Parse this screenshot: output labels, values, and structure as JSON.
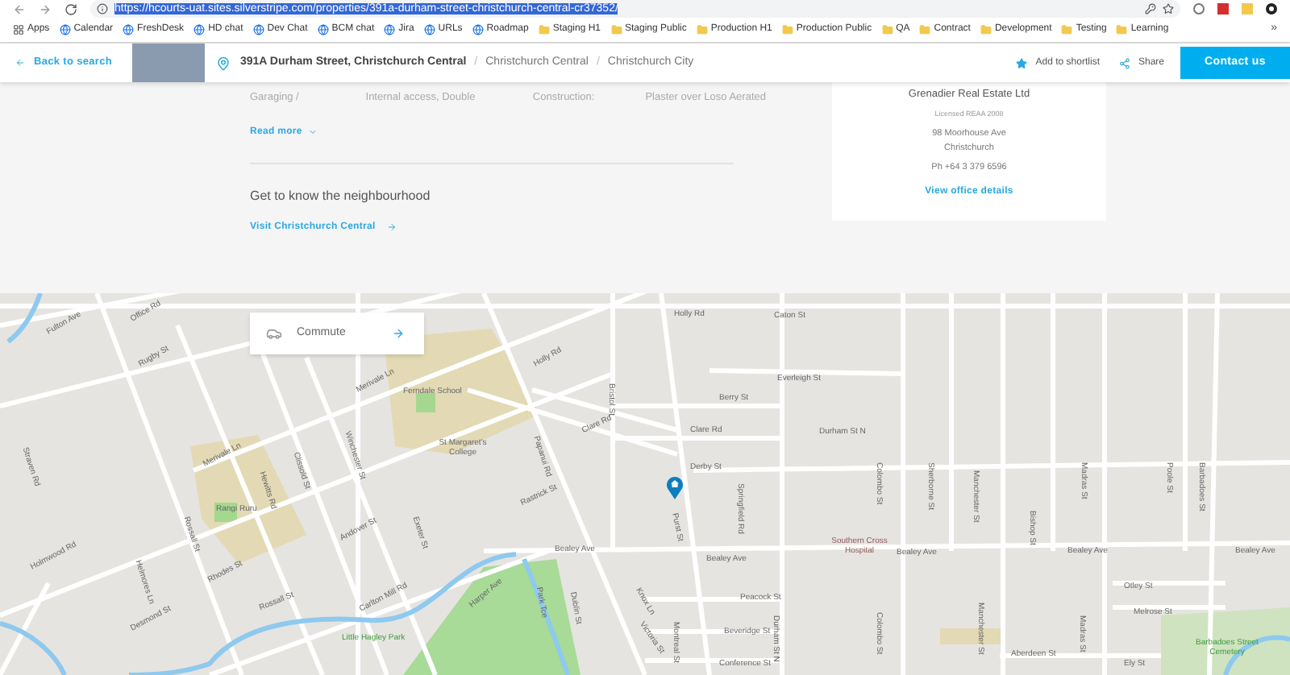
{
  "browser": {
    "url": "https://hcourts-uat.sites.silverstripe.com/properties/391a-durham-street-christchurch-central-cr37352/",
    "bookmarks": [
      {
        "label": "Apps",
        "kind": "apps"
      },
      {
        "label": "Calendar",
        "kind": "site"
      },
      {
        "label": "FreshDesk",
        "kind": "site"
      },
      {
        "label": "HD chat",
        "kind": "site"
      },
      {
        "label": "Dev Chat",
        "kind": "site"
      },
      {
        "label": "BCM chat",
        "kind": "site"
      },
      {
        "label": "Jira",
        "kind": "site"
      },
      {
        "label": "URLs",
        "kind": "site"
      },
      {
        "label": "Roadmap",
        "kind": "site"
      },
      {
        "label": "Staging H1",
        "kind": "folder"
      },
      {
        "label": "Staging Public",
        "kind": "folder"
      },
      {
        "label": "Production H1",
        "kind": "folder"
      },
      {
        "label": "Production Public",
        "kind": "folder"
      },
      {
        "label": "QA",
        "kind": "folder"
      },
      {
        "label": "Contract",
        "kind": "folder"
      },
      {
        "label": "Development",
        "kind": "folder"
      },
      {
        "label": "Testing",
        "kind": "folder"
      },
      {
        "label": "Learning",
        "kind": "folder"
      }
    ],
    "more": "»"
  },
  "header": {
    "back": "Back to search",
    "address": "391A Durham Street, Christchurch Central",
    "breadcrumbs": [
      "Christchurch Central",
      "Christchurch City"
    ],
    "separator": "/",
    "shortlist": "Add to shortlist",
    "share": "Share",
    "contact": "Contact us"
  },
  "details": {
    "row": [
      "Garaging /",
      "Internal access, Double",
      "Construction:",
      "Plaster over Loso Aerated"
    ],
    "read_more": "Read more",
    "neighbourhood_heading": "Get to know the neighbourhood",
    "visit_link": "Visit Christchurch Central"
  },
  "agency": {
    "name": "Grenadier Real Estate Ltd",
    "licence": "Licensed REAA 2008",
    "address_lines": [
      "98 Moorhouse Ave",
      "Christchurch"
    ],
    "phone": "Ph +64 3 379 6596",
    "link": "View office details"
  },
  "map": {
    "commute": "Commute",
    "labels": [
      {
        "text": "Fulton Ave"
      },
      {
        "text": "Office Rd"
      },
      {
        "text": "Rugby St"
      },
      {
        "text": "Merivale Ln"
      },
      {
        "text": "Ferndale School",
        "kind": "school"
      },
      {
        "text": "St Margaret's College",
        "kind": "school"
      },
      {
        "text": "Merivale Ln"
      },
      {
        "text": "Rangi Ruru",
        "kind": "school"
      },
      {
        "text": "Holly Rd"
      },
      {
        "text": "Holly Rd"
      },
      {
        "text": "Caton St"
      },
      {
        "text": "Papanui Rd"
      },
      {
        "text": "Clare Rd"
      },
      {
        "text": "Clare Rd"
      },
      {
        "text": "Berry St"
      },
      {
        "text": "Everleigh St"
      },
      {
        "text": "Durham St N"
      },
      {
        "text": "Derby St"
      },
      {
        "text": "Bristol St"
      },
      {
        "text": "Springfield Rd"
      },
      {
        "text": "Purst St"
      },
      {
        "text": "Bealey Ave"
      },
      {
        "text": "Bealey Ave"
      },
      {
        "text": "Southern Cross Hospital",
        "kind": "hospital"
      },
      {
        "text": "Bealey Ave"
      },
      {
        "text": "Bealey Ave"
      },
      {
        "text": "Bealey Ave"
      },
      {
        "text": "Colombo St"
      },
      {
        "text": "Sherborne St"
      },
      {
        "text": "Manchester St"
      },
      {
        "text": "Bishop St"
      },
      {
        "text": "Madras St"
      },
      {
        "text": "Poole St"
      },
      {
        "text": "Barbadoes St"
      },
      {
        "text": "Winchester St"
      },
      {
        "text": "Clissold St"
      },
      {
        "text": "Hewitts Rd"
      },
      {
        "text": "Straven Rd"
      },
      {
        "text": "Rossall St"
      },
      {
        "text": "Holmwood Rd"
      },
      {
        "text": "Helmores Ln"
      },
      {
        "text": "Rhodes St"
      },
      {
        "text": "Andover St"
      },
      {
        "text": "Exeter St"
      },
      {
        "text": "Rastrick St"
      },
      {
        "text": "Carlton Mill Rd"
      },
      {
        "text": "Desmond St"
      },
      {
        "text": "Rossall St"
      },
      {
        "text": "Harper Ave"
      },
      {
        "text": "Park Tce"
      },
      {
        "text": "Dublin St"
      },
      {
        "text": "Little Hagley Park",
        "kind": "park"
      },
      {
        "text": "Knox Ln"
      },
      {
        "text": "Peacock St"
      },
      {
        "text": "Montreal St"
      },
      {
        "text": "Beveridge St"
      },
      {
        "text": "Durham St N"
      },
      {
        "text": "Conference St"
      },
      {
        "text": "Victoria St"
      },
      {
        "text": "Colombo St"
      },
      {
        "text": "Manchester St"
      },
      {
        "text": "Madras St"
      },
      {
        "text": "Otley St"
      },
      {
        "text": "Melrose St"
      },
      {
        "text": "Aberdeen St"
      },
      {
        "text": "Ely St"
      },
      {
        "text": "Barbadoes Street Cemetery",
        "kind": "park"
      }
    ]
  }
}
